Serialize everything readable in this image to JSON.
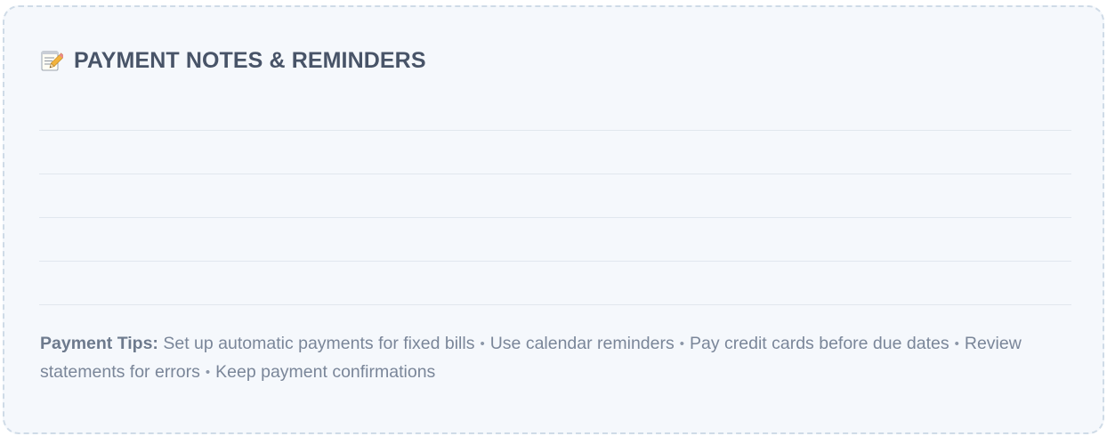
{
  "notes_card": {
    "icon": "memo-pencil-icon",
    "title": "PAYMENT NOTES & REMINDERS",
    "note_lines": 5,
    "tips_label": "Payment Tips:",
    "tips": [
      "Set up automatic payments for fixed bills",
      "Use calendar reminders",
      "Pay credit cards before due dates",
      "Review statements for errors",
      "Keep payment confirmations"
    ],
    "bullet": "•"
  },
  "colors": {
    "card_background": "#f5f8fc",
    "card_border": "#cfdbe7",
    "title_text": "#485468",
    "tips_text": "#7a8699",
    "rule_line": "#e1e7ee"
  }
}
